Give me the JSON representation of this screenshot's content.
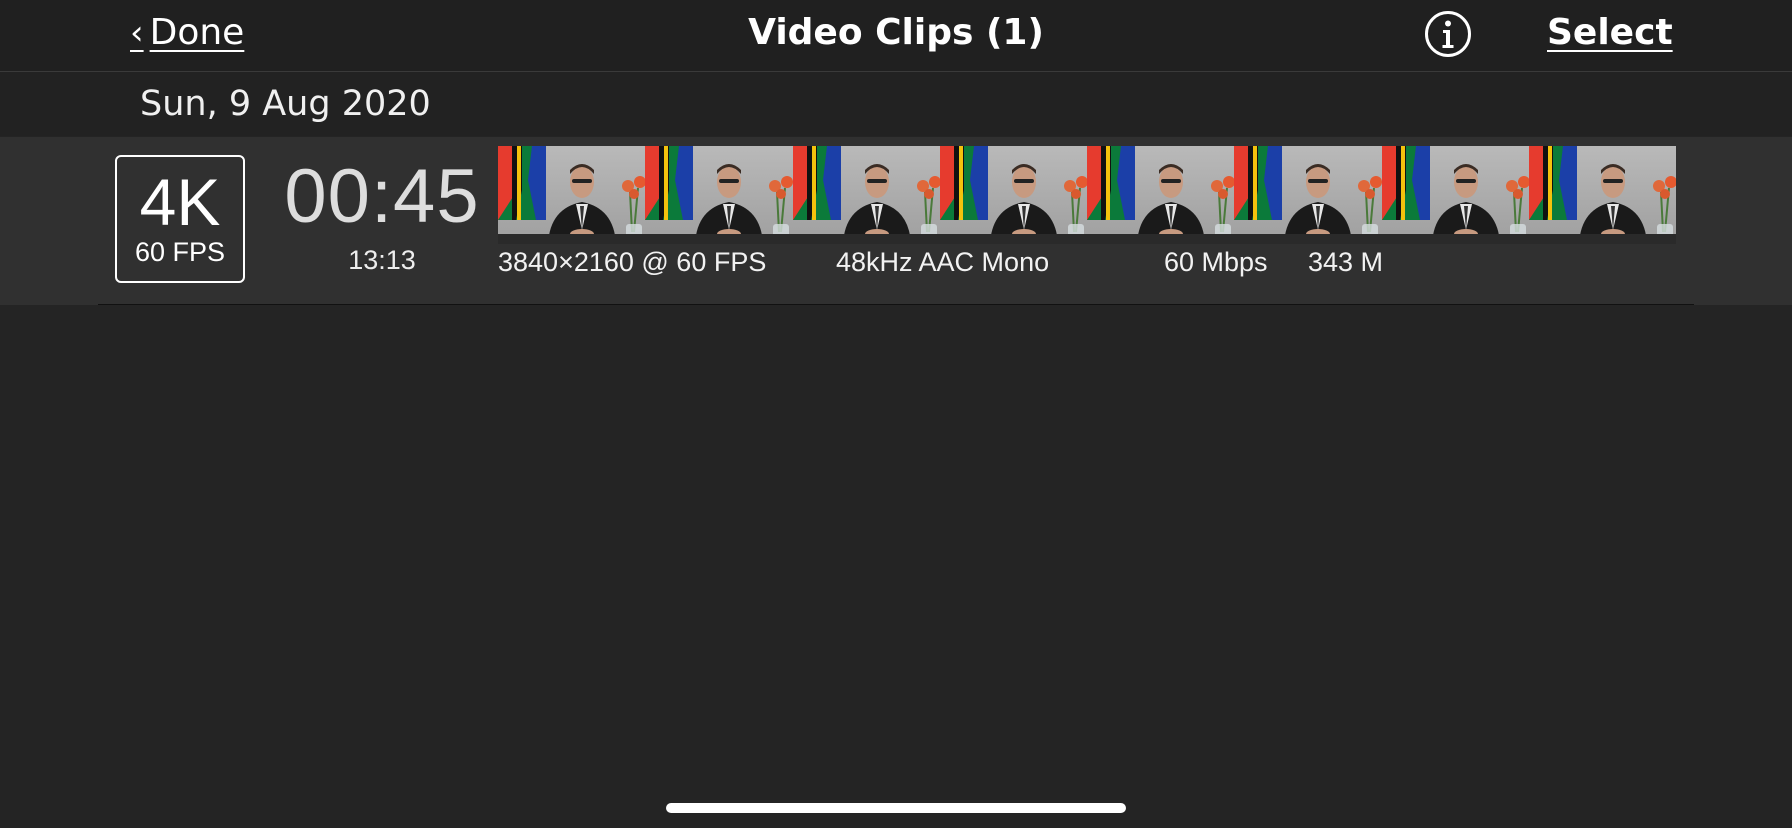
{
  "navbar": {
    "done_label": "Done",
    "title": "Video Clips (1)",
    "info_icon": "info-circle-icon",
    "select_label": "Select"
  },
  "section": {
    "date": "Sun, 9 Aug 2020"
  },
  "clip": {
    "resolution_badge": "4K",
    "fps_badge": "60 FPS",
    "duration": "00:45",
    "time": "13:13",
    "dimensions": "3840×2160 @ 60 FPS",
    "audio": "48kHz AAC Mono",
    "bitrate": "60 Mbps",
    "size": "343 M",
    "frame_count": 8
  },
  "colors": {
    "background": "#242424",
    "navbar": "#202020",
    "row": "#303030",
    "text": "#ffffff"
  }
}
